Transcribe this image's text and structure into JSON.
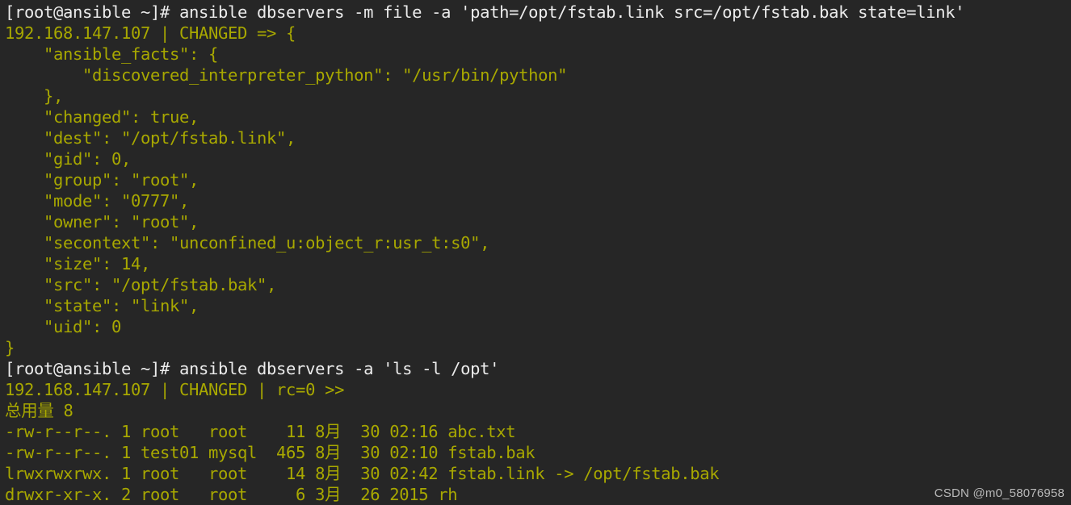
{
  "terminal": {
    "background_color": "#262626",
    "prompt_color": "#ececec",
    "output_color": "#a8a800",
    "watermark_color": "#b9b9b9",
    "watermark": "CSDN @m0_58076958",
    "lines": [
      {
        "type": "prompt",
        "text": "[root@ansible ~]# ansible dbservers -m file -a 'path=/opt/fstab.link src=/opt/fstab.bak state=link'"
      },
      {
        "type": "out",
        "text": "192.168.147.107 | CHANGED => {"
      },
      {
        "type": "out",
        "text": "    \"ansible_facts\": {"
      },
      {
        "type": "out",
        "text": "        \"discovered_interpreter_python\": \"/usr/bin/python\""
      },
      {
        "type": "out",
        "text": "    },"
      },
      {
        "type": "out",
        "text": "    \"changed\": true,"
      },
      {
        "type": "out",
        "text": "    \"dest\": \"/opt/fstab.link\","
      },
      {
        "type": "out",
        "text": "    \"gid\": 0,"
      },
      {
        "type": "out",
        "text": "    \"group\": \"root\","
      },
      {
        "type": "out",
        "text": "    \"mode\": \"0777\","
      },
      {
        "type": "out",
        "text": "    \"owner\": \"root\","
      },
      {
        "type": "out",
        "text": "    \"secontext\": \"unconfined_u:object_r:usr_t:s0\","
      },
      {
        "type": "out",
        "text": "    \"size\": 14,"
      },
      {
        "type": "out",
        "text": "    \"src\": \"/opt/fstab.bak\","
      },
      {
        "type": "out",
        "text": "    \"state\": \"link\","
      },
      {
        "type": "out",
        "text": "    \"uid\": 0"
      },
      {
        "type": "out",
        "text": "}"
      },
      {
        "type": "prompt",
        "text": "[root@ansible ~]# ansible dbservers -a 'ls -l /opt'"
      },
      {
        "type": "out",
        "text": "192.168.147.107 | CHANGED | rc=0 >>"
      },
      {
        "type": "out",
        "text": "总用量 8"
      },
      {
        "type": "out",
        "text": "-rw-r--r--. 1 root   root    11 8月  30 02:16 abc.txt"
      },
      {
        "type": "out",
        "text": "-rw-r--r--. 1 test01 mysql  465 8月  30 02:10 fstab.bak"
      },
      {
        "type": "out",
        "text": "lrwxrwxrwx. 1 root   root    14 8月  30 02:42 fstab.link -> /opt/fstab.bak"
      },
      {
        "type": "out",
        "text": "drwxr-xr-x. 2 root   root     6 3月  26 2015 rh"
      }
    ]
  }
}
